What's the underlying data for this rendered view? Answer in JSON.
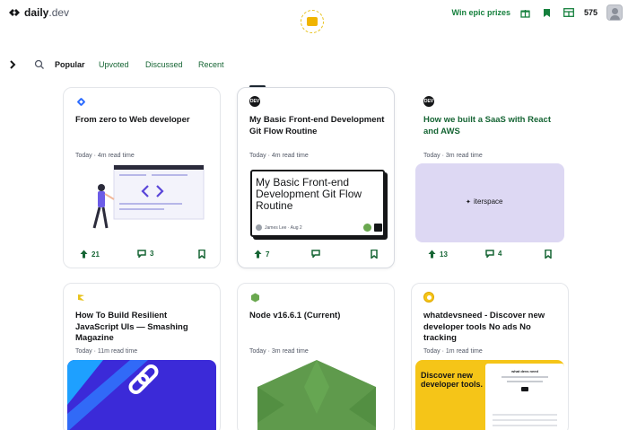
{
  "header": {
    "logo_word": "daily",
    "logo_suffix": ".dev",
    "prizes_label": "Win epic prizes",
    "reputation": "575",
    "icons": [
      "gift-icon",
      "bookmark-icon",
      "layout-icon"
    ]
  },
  "filters": {
    "tabs": [
      {
        "label": "Popular",
        "active": true
      },
      {
        "label": "Upvoted",
        "active": false
      },
      {
        "label": "Discussed",
        "active": false
      },
      {
        "label": "Recent",
        "active": false
      }
    ]
  },
  "colors": {
    "accent": "#15803d",
    "brand_yellow": "#f0b400"
  },
  "cards": [
    {
      "title": "From zero to Web developer",
      "meta": "Today · 4m read time",
      "upvotes": "21",
      "comments": "3",
      "source_icon": "diamond-blue-icon"
    },
    {
      "title": "My Basic Front-end Development Git Flow Routine",
      "meta": "Today · 4m read time",
      "upvotes": "7",
      "comments": "",
      "image_title": "My Basic Front-end Development Git Flow Routine",
      "image_author": "James Lee · Aug 2",
      "source_icon": "dev-icon"
    },
    {
      "title": "How we built a SaaS with React and AWS",
      "meta": "Today · 3m read time",
      "upvotes": "13",
      "comments": "4",
      "image_text": "iterspace",
      "source_icon": "dev-icon"
    },
    {
      "title": "How To Build Resilient JavaScript UIs — Smashing Magazine",
      "meta": "Today · 11m read time",
      "source_icon": "smashing-icon"
    },
    {
      "title": "Node v16.6.1 (Current)",
      "meta": "Today · 3m read time",
      "source_icon": "node-icon"
    },
    {
      "title": "whatdevsneed - Discover new developer tools No ads No tracking",
      "meta": "Today · 1m read time",
      "image_headline": "Discover new developer tools.",
      "image_mini_title": "what devs need",
      "source_icon": "whatdevsneed-icon"
    }
  ]
}
